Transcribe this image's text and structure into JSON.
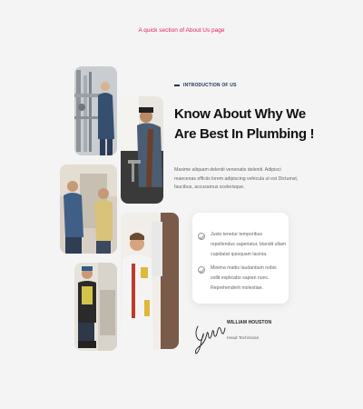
{
  "caption": "A quick section of About Us page",
  "section": {
    "eyebrow": "INTRODUCTION OF US",
    "title": "Know About Why We Are Best In Plumbing !",
    "description": "Maxime aliquam deleniti venenatis deleniti. Adipisci maecenas officiis lorem adipiscing vehicula ut est Dictumst, faucibus, accusamus scelerisque."
  },
  "checklist": [
    {
      "text": "Justo tenetur temporibus repellendus saperiatur, blandit ullam cupidatat quisquam lacinia."
    },
    {
      "text": "Minima mattis laudantium nobis sollit explicabo sapien nunc. Reprehenderit molestiae."
    }
  ],
  "author": {
    "name": "WILLIAM HOUSTON",
    "role": "Head Technician"
  },
  "icons": [
    "check-circle-icon",
    "check-circle-icon"
  ],
  "colors": {
    "accent": "#1f2f55",
    "caption": "#e0245e",
    "background": "#f4f4f4"
  }
}
